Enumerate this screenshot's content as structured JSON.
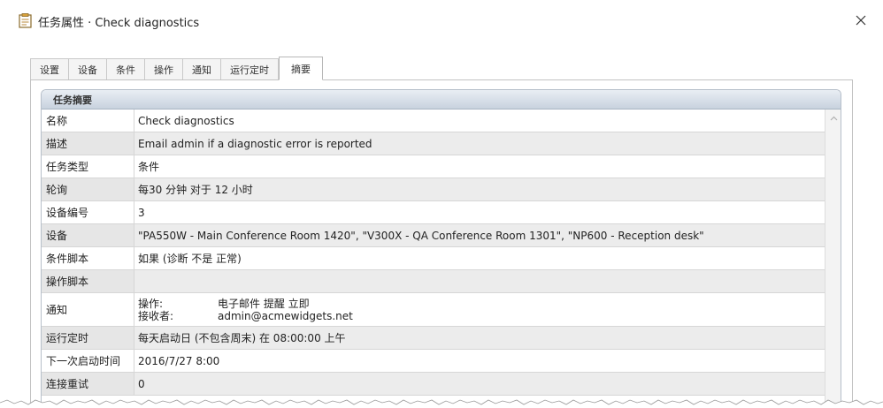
{
  "window": {
    "title": "任务属性 · Check diagnostics",
    "close_glyph": "✕"
  },
  "tabs": [
    {
      "label": "设置",
      "active": false
    },
    {
      "label": "设备",
      "active": false
    },
    {
      "label": "条件",
      "active": false
    },
    {
      "label": "操作",
      "active": false
    },
    {
      "label": "通知",
      "active": false
    },
    {
      "label": "运行定时",
      "active": false
    },
    {
      "label": "摘要",
      "active": true
    }
  ],
  "summary": {
    "header": "任务摘要",
    "rows": [
      {
        "label": "名称",
        "value": "Check diagnostics"
      },
      {
        "label": "描述",
        "value": "Email admin if a diagnostic error is reported"
      },
      {
        "label": "任务类型",
        "value": "条件"
      },
      {
        "label": "轮询",
        "value": "每30 分钟 对于 12 小时"
      },
      {
        "label": "设备编号",
        "value": "3"
      },
      {
        "label": "设备",
        "value": "\"PA550W - Main Conference Room 1420\",  \"V300X - QA Conference Room 1301\",  \"NP600 - Reception desk\""
      },
      {
        "label": "条件脚本",
        "value": "如果 (诊断 不是 正常)"
      },
      {
        "label": "操作脚本",
        "value": ""
      },
      {
        "label": "通知",
        "value": ""
      },
      {
        "label": "运行定时",
        "value": "每天启动日 (不包含周末) 在 08:00:00 上午"
      },
      {
        "label": "下一次启动时间",
        "value": "2016/7/27 8:00"
      },
      {
        "label": "连接重试",
        "value": "0"
      }
    ],
    "notification": {
      "action_label": "操作:",
      "action_value": "电子邮件 提醒 立即",
      "recipient_label": "接收者:",
      "recipient_value": "admin@acmewidgets.net"
    }
  },
  "icons": {
    "title": "task-properties-icon",
    "close": "close-icon",
    "scroll_up": "chevron-up-icon"
  }
}
